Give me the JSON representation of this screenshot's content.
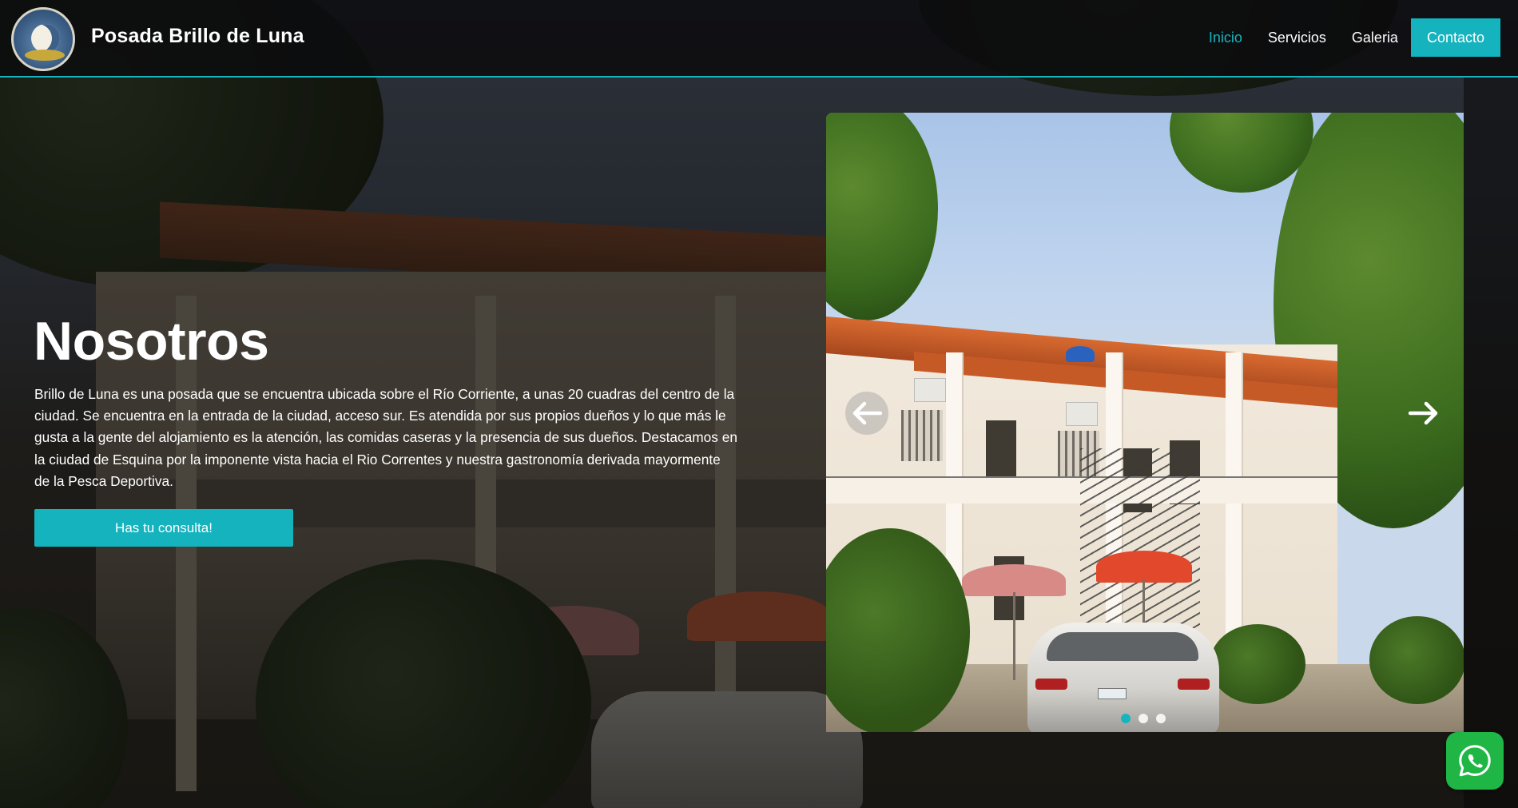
{
  "header": {
    "brand": "Posada Brillo de Luna",
    "logo_icon": "posada-logo-moon-fish",
    "nav": [
      {
        "label": "Inicio",
        "active": true
      },
      {
        "label": "Servicios",
        "active": false
      },
      {
        "label": "Galeria",
        "active": false
      },
      {
        "label": "Contacto",
        "active": false,
        "cta": true
      }
    ]
  },
  "hero": {
    "title": "Nosotros",
    "text": "Brillo de Luna es una posada que se encuentra ubicada sobre el Río Corriente, a unas 20 cuadras del centro de la ciudad. Se encuentra en la entrada de la ciudad, acceso sur. Es atendida por sus propios dueños y lo que más le gusta a la gente del alojamiento es la atención, las comidas caseras y la presencia de sus dueños. Destacamos en la ciudad de Esquina por la imponente vista hacia el Rio Correntes y nuestra gastronomía derivada mayormente de la Pesca Deportiva.",
    "button_label": "Has tu consulta!"
  },
  "carousel": {
    "prev_icon": "arrow-left-icon",
    "next_icon": "arrow-right-icon",
    "slides": 3,
    "active_slide": 1
  },
  "whatsapp": {
    "icon": "whatsapp-icon"
  },
  "colors": {
    "accent": "#16b4bf",
    "whatsapp": "#1fb645",
    "header_bg": "#0c0c0e"
  }
}
